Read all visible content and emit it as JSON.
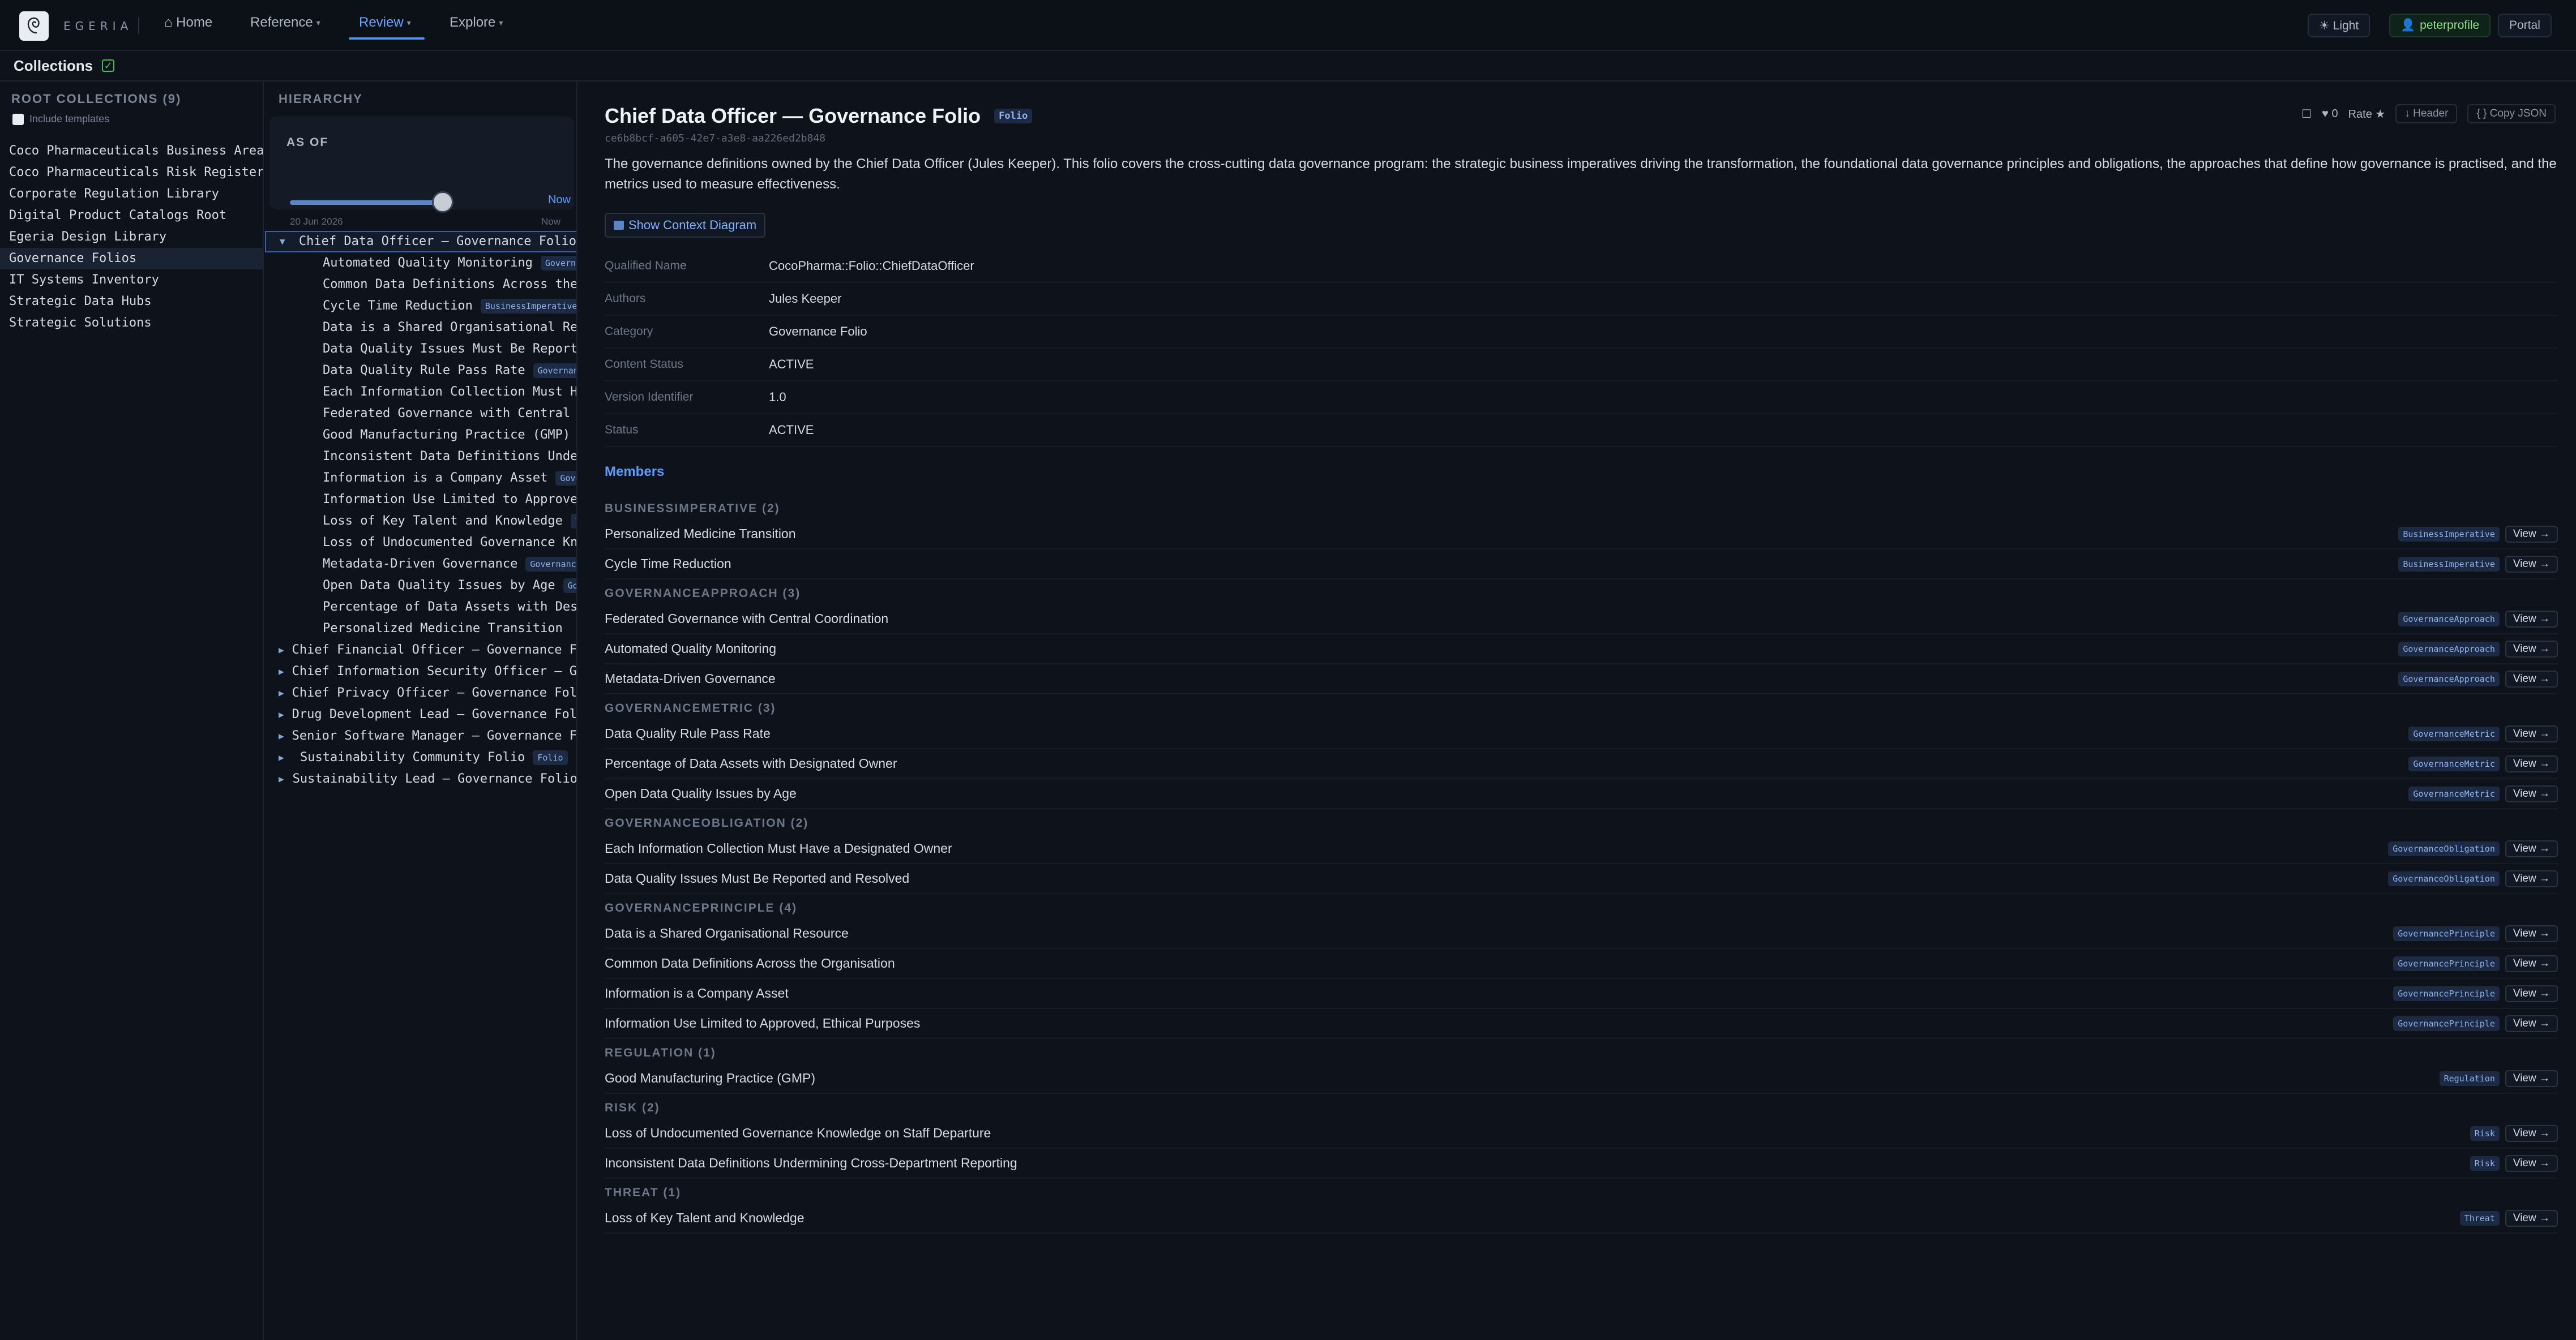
{
  "app": {
    "brand": "EGERIA",
    "nav": [
      {
        "id": "home",
        "label": "⌂ Home",
        "has_caret": false,
        "active": false
      },
      {
        "id": "reference",
        "label": "Reference",
        "has_caret": true,
        "active": false
      },
      {
        "id": "review",
        "label": "Review",
        "has_caret": true,
        "active": true
      },
      {
        "id": "explore",
        "label": "Explore",
        "has_caret": true,
        "active": false
      }
    ],
    "right": {
      "theme_label": "☀ Light",
      "user_label": "peterprofile",
      "portal_label": "Portal"
    }
  },
  "subheader": {
    "title": "Collections"
  },
  "root_collections": {
    "heading": "ROOT COLLECTIONS (9)",
    "include_templates_label": "Include templates",
    "items": [
      "Coco Pharmaceuticals Business Area",
      "Coco Pharmaceuticals Risk Register",
      "Corporate Regulation Library",
      "Digital Product Catalogs Root",
      "Egeria Design Library",
      "Governance Folios",
      "IT Systems Inventory",
      "Strategic Data Hubs",
      "Strategic Solutions"
    ],
    "selected_index": 5
  },
  "hierarchy": {
    "heading": "HIERARCHY",
    "as_of": {
      "label": "AS OF",
      "now_label": "Now",
      "start_date": "20 Jun 2026",
      "end_label": "Now",
      "position": 0.9
    },
    "root": {
      "label": "Chief Data Officer — Governance Folio",
      "expanded": true
    },
    "children": [
      {
        "label": "Automated Quality Monitoring",
        "badge": "GovernanceApproach"
      },
      {
        "label": "Common Data Definitions Across the Organisation",
        "badge": ""
      },
      {
        "label": "Cycle Time Reduction",
        "badge": "BusinessImperative"
      },
      {
        "label": "Data is a Shared Organisational Resource",
        "badge": ""
      },
      {
        "label": "Data Quality Issues Must Be Reported and Resolved",
        "badge": ""
      },
      {
        "label": "Data Quality Rule Pass Rate",
        "badge": "GovernanceMetric"
      },
      {
        "label": "Each Information Collection Must Have a Designated Owner",
        "badge": ""
      },
      {
        "label": "Federated Governance with Central Coordination",
        "badge": ""
      },
      {
        "label": "Good Manufacturing Practice (GMP)",
        "badge": ""
      },
      {
        "label": "Inconsistent Data Definitions Undermining Cross-Department Reporting",
        "badge": ""
      },
      {
        "label": "Information is a Company Asset",
        "badge": "GovernancePrinciple"
      },
      {
        "label": "Information Use Limited to Approved, Ethical Purposes",
        "badge": ""
      },
      {
        "label": "Loss of Key Talent and Knowledge",
        "badge": "Threat"
      },
      {
        "label": "Loss of Undocumented Governance Knowledge on Staff Departure",
        "badge": ""
      },
      {
        "label": "Metadata-Driven Governance",
        "badge": "GovernanceApproach"
      },
      {
        "label": "Open Data Quality Issues by Age",
        "badge": "GovernanceMetric"
      },
      {
        "label": "Percentage of Data Assets with Designated Owner",
        "badge": ""
      },
      {
        "label": "Personalized Medicine Transition",
        "badge": ""
      }
    ],
    "other_roots": [
      {
        "label": "Chief Financial Officer — Governance Folio",
        "badge": ""
      },
      {
        "label": "Chief Information Security Officer — Governance Folio",
        "badge": ""
      },
      {
        "label": "Chief Privacy Officer — Governance Folio",
        "badge": ""
      },
      {
        "label": "Drug Development Lead — Governance Folio",
        "badge": ""
      },
      {
        "label": "Senior Software Manager — Governance Folio",
        "badge": ""
      },
      {
        "label": "Sustainability Community Folio",
        "badge": "Folio"
      },
      {
        "label": "Sustainability Lead — Governance Folio",
        "badge": ""
      }
    ]
  },
  "detail": {
    "title": "Chief Data Officer — Governance Folio",
    "type_badge": "Folio",
    "guid": "ce6b8bcf-a605-42e7-a3e8-aa226ed2b848",
    "likes": "0",
    "rate_label": "Rate ★",
    "header_label": "↓ Header",
    "copy_json_label": "{ } Copy JSON",
    "description": "The governance definitions owned by the Chief Data Officer (Jules Keeper). This folio covers the cross-cutting data governance program: the strategic business imperatives driving the transformation, the foundational data governance principles and obligations, the approaches that define how governance is practised, and the metrics used to measure effectiveness.",
    "context_button_label": "Show Context Diagram",
    "properties": [
      {
        "key": "Qualified Name",
        "value": "CocoPharma::Folio::ChiefDataOfficer"
      },
      {
        "key": "Authors",
        "value": "Jules Keeper"
      },
      {
        "key": "Category",
        "value": "Governance Folio"
      },
      {
        "key": "Content Status",
        "value": "ACTIVE"
      },
      {
        "key": "Version Identifier",
        "value": "1.0"
      },
      {
        "key": "Status",
        "value": "ACTIVE"
      }
    ],
    "members_heading": "Members",
    "view_label": "View →",
    "groups": [
      {
        "heading": "BUSINESSIMPERATIVE (2)",
        "badge": "BusinessImperative",
        "items": [
          "Personalized Medicine Transition",
          "Cycle Time Reduction"
        ]
      },
      {
        "heading": "GOVERNANCEAPPROACH (3)",
        "badge": "GovernanceApproach",
        "items": [
          "Federated Governance with Central Coordination",
          "Automated Quality Monitoring",
          "Metadata-Driven Governance"
        ]
      },
      {
        "heading": "GOVERNANCEMETRIC (3)",
        "badge": "GovernanceMetric",
        "items": [
          "Data Quality Rule Pass Rate",
          "Percentage of Data Assets with Designated Owner",
          "Open Data Quality Issues by Age"
        ]
      },
      {
        "heading": "GOVERNANCEOBLIGATION (2)",
        "badge": "GovernanceObligation",
        "items": [
          "Each Information Collection Must Have a Designated Owner",
          "Data Quality Issues Must Be Reported and Resolved"
        ]
      },
      {
        "heading": "GOVERNANCEPRINCIPLE (4)",
        "badge": "GovernancePrinciple",
        "items": [
          "Data is a Shared Organisational Resource",
          "Common Data Definitions Across the Organisation",
          "Information is a Company Asset",
          "Information Use Limited to Approved, Ethical Purposes"
        ]
      },
      {
        "heading": "REGULATION (1)",
        "badge": "Regulation",
        "items": [
          "Good Manufacturing Practice (GMP)"
        ]
      },
      {
        "heading": "RISK (2)",
        "badge": "Risk",
        "items": [
          "Loss of Undocumented Governance Knowledge on Staff Departure",
          "Inconsistent Data Definitions Undermining Cross-Department Reporting"
        ]
      },
      {
        "heading": "THREAT (1)",
        "badge": "Threat",
        "items": [
          "Loss of Key Talent and Knowledge"
        ]
      }
    ]
  },
  "colors": {
    "accent": "#5e9cf6",
    "background": "#0e131b",
    "success": "#3fbf5a"
  }
}
